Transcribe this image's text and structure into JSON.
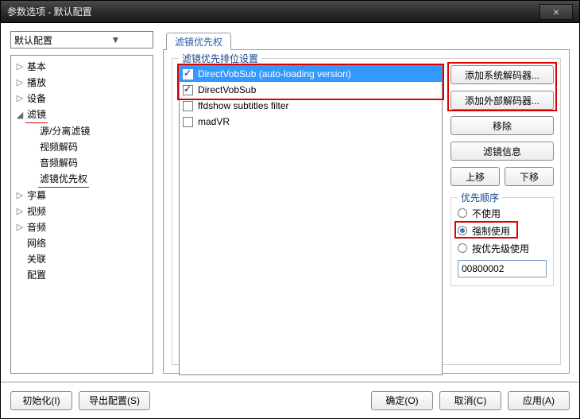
{
  "title": "参数选项 - 默认配置",
  "config_select": "默认配置",
  "tree": {
    "basic": "基本",
    "playback": "播放",
    "device": "设备",
    "filter": "滤镜",
    "filter_children": {
      "src_split": "源/分离滤镜",
      "vdec": "视频解码",
      "adec": "音频解码",
      "prio": "滤镜优先权"
    },
    "subtitles": "字幕",
    "video": "视频",
    "audio": "音频",
    "network": "网络",
    "assoc": "关联",
    "config": "配置"
  },
  "tab": "滤镜优先权",
  "fs_legend": "滤镜优先排位设置",
  "filters": [
    "DirectVobSub (auto-loading version)",
    "DirectVobSub",
    "ffdshow subtitles filter",
    "madVR"
  ],
  "checked": [
    true,
    true,
    false,
    false
  ],
  "btns": {
    "add_sys": "添加系统解码器...",
    "add_ext": "添加外部解码器...",
    "remove": "移除",
    "info": "滤镜信息",
    "up": "上移",
    "down": "下移"
  },
  "prio": {
    "legend": "优先顺序",
    "r1": "不使用",
    "r2": "强制使用",
    "r3": "按优先级使用",
    "value": "00800002"
  },
  "footer": {
    "init": "初始化(I)",
    "export": "导出配置(S)",
    "ok": "确定(O)",
    "cancel": "取消(C)",
    "apply": "应用(A)"
  }
}
